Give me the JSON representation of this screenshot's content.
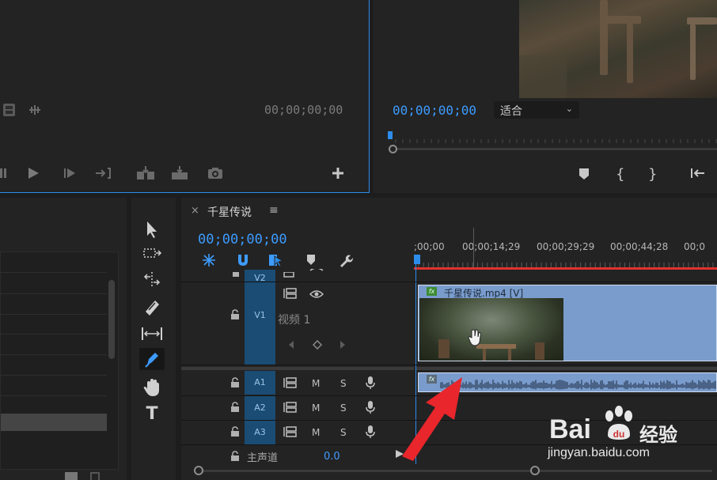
{
  "source_monitor": {
    "timecode": "00;00;00;00"
  },
  "program_monitor": {
    "timecode": "00;00;00;00",
    "fit_value": "适合"
  },
  "timeline": {
    "close_label": "×",
    "sequence_name": "千星传说",
    "menu_label": "≡",
    "timecode": "00;00;00;00",
    "ruler_ticks": [
      ";00;00",
      "00;00;14;29",
      "00;00;29;29",
      "00;00;44;28",
      "00;0"
    ],
    "tracks": {
      "v2": "V2",
      "v1": "V1",
      "v1_name": "视频 1",
      "a1": "A1",
      "a2": "A2",
      "a3": "A3",
      "master_name": "主声道",
      "master_value": "0.0"
    },
    "mute_label": "M",
    "solo_label": "S",
    "video_clip_title": "千星传说.mp4 [V]",
    "fx_label": "fx"
  },
  "watermark": {
    "brand": "Bai",
    "brand_suffix": "经验",
    "url": "jingyan.baidu.com"
  },
  "colors": {
    "accent_blue": "#3d9bff",
    "track_blue": "#1a4c74",
    "clip_blue": "#7a9ccd",
    "playhead_red": "#e0322e",
    "arrow_red": "#e8262b"
  }
}
